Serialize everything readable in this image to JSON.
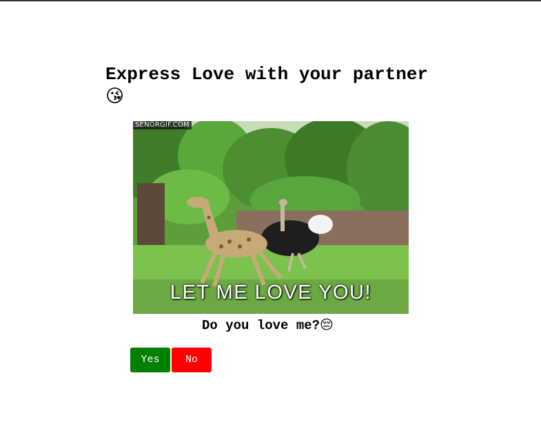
{
  "heading": {
    "text": "Express Love with your partner",
    "emoji": "😘"
  },
  "gif": {
    "watermark": "SENORGIF.COM",
    "caption": "LET ME LOVE YOU!"
  },
  "question": {
    "text": "Do you love me?",
    "emoji": "😔"
  },
  "buttons": {
    "yes_label": "Yes",
    "no_label": "No"
  },
  "colors": {
    "yes_button": "#008000",
    "no_button": "#ff0000",
    "top_rule": "#333333"
  }
}
